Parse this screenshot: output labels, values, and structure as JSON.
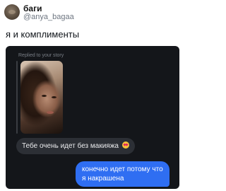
{
  "tweet": {
    "display_name": "баги",
    "handle": "@anya_bagaa",
    "text": "я и комплименты",
    "avatar_icon": "avatar-photo"
  },
  "dm": {
    "reply_label": "Replied to your story",
    "story_icon": "story-photo",
    "messages": [
      {
        "direction": "incoming",
        "text": "Тебе очень идет без макияжа",
        "emoji": "heart-eyes-emoji"
      },
      {
        "direction": "outgoing",
        "text": "конечно идет потому что я накрашена"
      }
    ],
    "colors": {
      "background": "#14161a",
      "incoming_bubble": "#2c2f35",
      "outgoing_bubble": "#2f6ef2"
    }
  }
}
